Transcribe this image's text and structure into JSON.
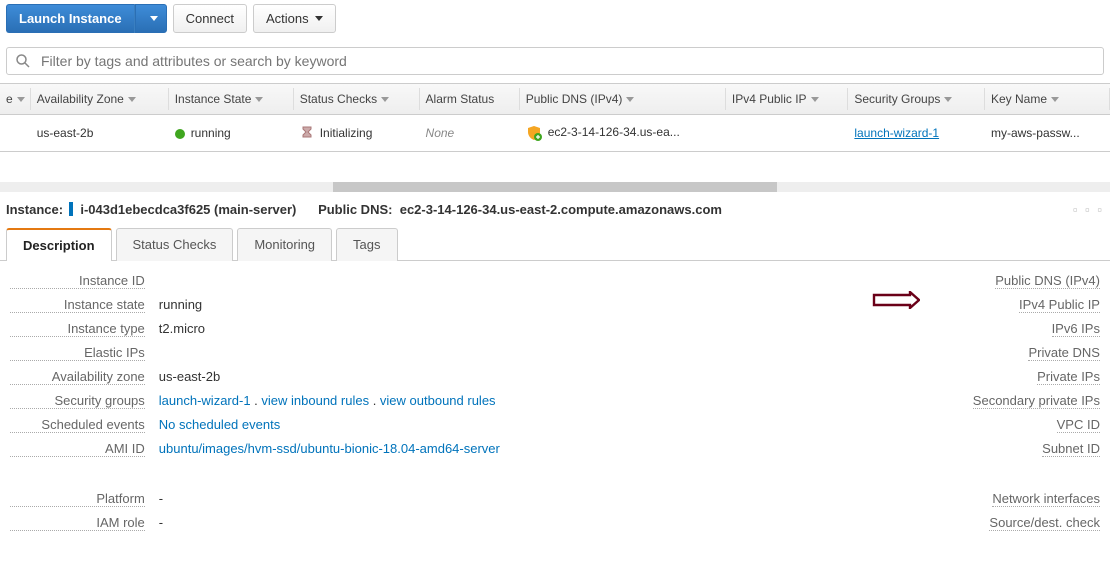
{
  "toolbar": {
    "launch": "Launch Instance",
    "connect": "Connect",
    "actions": "Actions"
  },
  "search": {
    "placeholder": "Filter by tags and attributes or search by keyword"
  },
  "columns": {
    "c0": "e",
    "az": "Availability Zone",
    "state": "Instance State",
    "status": "Status Checks",
    "alarm": "Alarm Status",
    "dns": "Public DNS (IPv4)",
    "ip": "IPv4 Public IP",
    "sg": "Security Groups",
    "key": "Key Name"
  },
  "row": {
    "az": "us-east-2b",
    "state": "running",
    "status": "Initializing",
    "alarm": "None",
    "dns": "ec2-3-14-126-34.us-ea...",
    "ip": "",
    "sg": "launch-wizard-1",
    "key": "my-aws-passw..."
  },
  "detail": {
    "instance_label": "Instance:",
    "instance_id": "i-043d1ebecdca3f625 (main-server)",
    "dns_label": "Public DNS:",
    "dns_value": "ec2-3-14-126-34.us-east-2.compute.amazonaws.com"
  },
  "tabs": {
    "desc": "Description",
    "status": "Status Checks",
    "mon": "Monitoring",
    "tags": "Tags"
  },
  "left": {
    "instance_id_l": "Instance ID",
    "instance_state_l": "Instance state",
    "instance_state_v": "running",
    "instance_type_l": "Instance type",
    "instance_type_v": "t2.micro",
    "elastic_ips_l": "Elastic IPs",
    "az_l": "Availability zone",
    "az_v": "us-east-2b",
    "sg_l": "Security groups",
    "sg_v": "launch-wizard-1",
    "sg_in": "view inbound rules",
    "sg_out": "view outbound rules",
    "sched_l": "Scheduled events",
    "sched_v": "No scheduled events",
    "ami_l": "AMI ID",
    "ami_v": "ubuntu/images/hvm-ssd/ubuntu-bionic-18.04-amd64-server",
    "platform_l": "Platform",
    "platform_v": "-",
    "iam_l": "IAM role",
    "iam_v": "-"
  },
  "right": {
    "pdns": "Public DNS (IPv4)",
    "pip": "IPv4 Public IP",
    "ipv6": "IPv6 IPs",
    "prdns": "Private DNS",
    "prips": "Private IPs",
    "secip": "Secondary private IPs",
    "vpc": "VPC ID",
    "subnet": "Subnet ID",
    "netif": "Network interfaces",
    "sdchk": "Source/dest. check"
  }
}
